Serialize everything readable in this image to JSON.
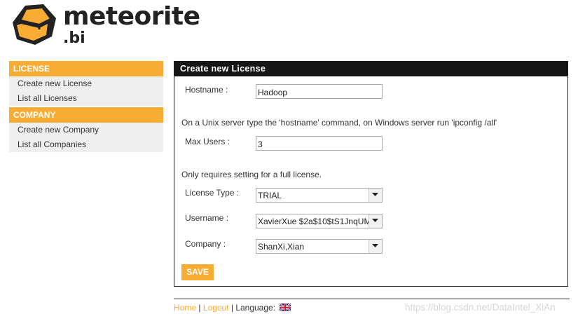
{
  "brand": {
    "name": "meteorite",
    "suffix": ".bi",
    "accent": "#f9ac34",
    "dark": "#161616"
  },
  "sidebar": {
    "sections": [
      {
        "title": "LICENSE",
        "items": [
          "Create new License",
          "List all Licenses"
        ]
      },
      {
        "title": "COMPANY",
        "items": [
          "Create new Company",
          "List all Companies"
        ]
      }
    ]
  },
  "form": {
    "title": "Create new License",
    "hostname": {
      "label": "Hostname :",
      "value": "Hadoop"
    },
    "hostname_hint": "On a Unix server type the 'hostname' command, on Windows server run 'ipconfig /all'",
    "max_users": {
      "label": "Max Users :",
      "value": "3"
    },
    "max_users_hint": "Only requires setting for a full license.",
    "license_type": {
      "label": "License Type :",
      "value": "TRIAL"
    },
    "username": {
      "label": "Username :",
      "value": "XavierXue $2a$10$tS1JnqUM"
    },
    "company": {
      "label": "Company :",
      "value": "ShanXi,Xian"
    },
    "save_label": "SAVE"
  },
  "footer": {
    "home": "Home",
    "sep1": " | ",
    "logout": "Logout",
    "sep2": " | ",
    "language_label": "Language:",
    "language_flag_icon": "uk-flag-icon"
  },
  "watermark": "https://blog.csdn.net/DataIntel_XiAn"
}
